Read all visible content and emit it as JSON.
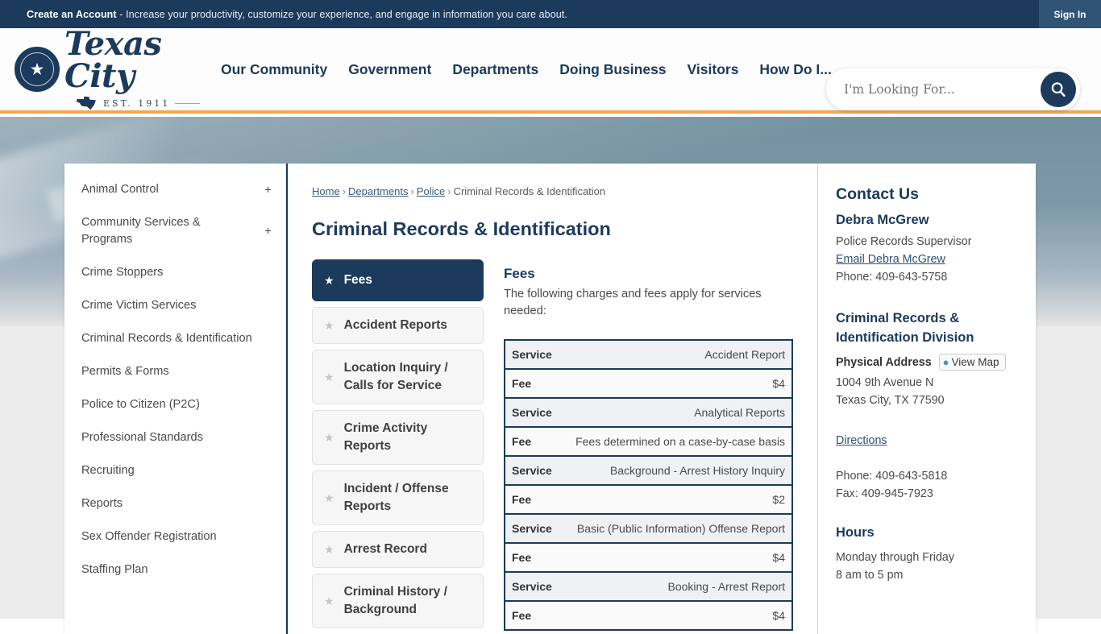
{
  "topbar": {
    "cta_bold": "Create an Account",
    "cta_rest": " - Increase your productivity, customize your experience, and engage in information you care about.",
    "signin": "Sign In"
  },
  "header": {
    "logo_name": "Texas City",
    "logo_est": "EST. 1911",
    "nav": [
      {
        "label": "Our Community"
      },
      {
        "label": "Government"
      },
      {
        "label": "Departments"
      },
      {
        "label": "Doing Business"
      },
      {
        "label": "Visitors"
      },
      {
        "label": "How Do I..."
      }
    ],
    "search_placeholder": "I'm Looking For..."
  },
  "sidebar": {
    "items": [
      {
        "label": "Animal Control",
        "expander": "+"
      },
      {
        "label": "Community Services & Programs",
        "expander": "+"
      },
      {
        "label": "Crime Stoppers",
        "expander": ""
      },
      {
        "label": "Crime Victim Services",
        "expander": ""
      },
      {
        "label": "Criminal Records & Identification",
        "expander": ""
      },
      {
        "label": "Permits & Forms",
        "expander": ""
      },
      {
        "label": "Police to Citizen (P2C)",
        "expander": ""
      },
      {
        "label": "Professional Standards",
        "expander": ""
      },
      {
        "label": "Recruiting",
        "expander": ""
      },
      {
        "label": "Reports",
        "expander": ""
      },
      {
        "label": "Sex Offender Registration",
        "expander": ""
      },
      {
        "label": "Staffing Plan",
        "expander": ""
      }
    ]
  },
  "breadcrumb": {
    "home": "Home",
    "departments": "Departments",
    "police": "Police",
    "current": "Criminal Records & Identification",
    "separator": "›"
  },
  "main": {
    "page_title": "Criminal Records & Identification",
    "tabs": [
      {
        "label": "Fees",
        "active": true
      },
      {
        "label": "Accident Reports",
        "active": false
      },
      {
        "label": "Location Inquiry / Calls for Service",
        "active": false
      },
      {
        "label": "Crime Activity Reports",
        "active": false
      },
      {
        "label": "Incident / Offense Reports",
        "active": false
      },
      {
        "label": "Arrest Record",
        "active": false
      },
      {
        "label": "Criminal History / Background",
        "active": false
      }
    ],
    "panel": {
      "heading": "Fees",
      "intro": "The following charges and fees apply for services needed:",
      "service_label": "Service",
      "fee_label": "Fee",
      "rows": [
        {
          "service": "Accident Report",
          "fee": "$4"
        },
        {
          "service": "Analytical Reports",
          "fee": "Fees determined on a case-by-case basis"
        },
        {
          "service": "Background - Arrest History Inquiry",
          "fee": "$2"
        },
        {
          "service": "Basic (Public Information) Offense Report",
          "fee": "$4"
        },
        {
          "service": "Booking - Arrest Report",
          "fee": "$4"
        }
      ]
    }
  },
  "contact": {
    "heading": "Contact Us",
    "name": "Debra McGrew",
    "title": "Police Records Supervisor",
    "email_link": "Email Debra McGrew",
    "phone": "Phone: 409-643-5758",
    "division": "Criminal Records & Identification Division",
    "address_label": "Physical Address",
    "view_map": "View Map",
    "address_line1": "1004 9th Avenue N",
    "address_line2": "Texas City, TX 77590",
    "directions": "Directions",
    "phone2": "Phone: 409-643-5818",
    "fax": "Fax: 409-945-7923",
    "hours_heading": "Hours",
    "hours_line1": "Monday through Friday",
    "hours_line2": "8 am to 5 pm"
  },
  "icons": {
    "search": "search-icon",
    "star": "★",
    "pin": "⏺"
  }
}
